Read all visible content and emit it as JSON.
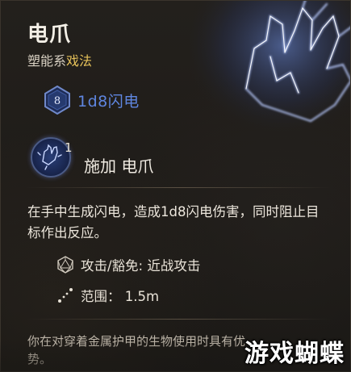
{
  "spell": {
    "name": "电爪",
    "school": "塑能系",
    "type": "戏法"
  },
  "damage": {
    "dice_label": "8",
    "text": "1d8闪电"
  },
  "cast": {
    "slot_count": "1",
    "label": "施加 电爪"
  },
  "description": "在手中生成闪电，造成1d8闪电伤害，同时阻止目标作出反应。",
  "stats": {
    "attack": "攻击/豁免: 近战攻击",
    "range": "范围： 1.5m"
  },
  "footnote": "你在对穿着金属护甲的生物使用时具有优势。",
  "watermark": "游戏蝴蝶",
  "colors": {
    "damage_text": "#5f86e0",
    "spell_type": "#e7c25a",
    "lightning": "#7aa2ff"
  },
  "icons": {
    "damage": "d8-die-icon",
    "cast": "electric-hand-icon",
    "attack": "d20-icon",
    "range": "range-line-icon",
    "hero": "lightning-hand-art"
  }
}
